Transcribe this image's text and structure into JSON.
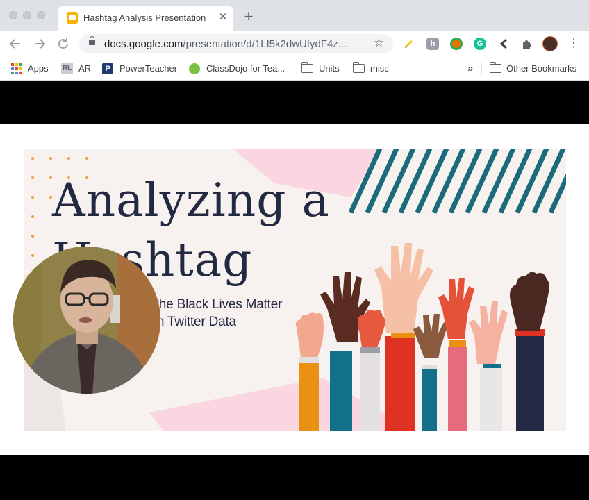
{
  "browser": {
    "tab": {
      "title": "Hashtag Analysis Presentation",
      "close_glyph": "✕"
    },
    "new_tab_glyph": "+",
    "omnibox": {
      "host": "docs.google.com",
      "path": "/presentation/d/1LI5k2dwUfydF4z..."
    },
    "bookmarks": [
      {
        "label": "Apps"
      },
      {
        "label": "AR"
      },
      {
        "label": "PowerTeacher"
      },
      {
        "label": "ClassDojo for Tea..."
      },
      {
        "label": "Units"
      },
      {
        "label": "misc"
      }
    ],
    "overflow_glyph": "»",
    "other_bookmarks": "Other Bookmarks",
    "ext_badges": {
      "honey": "h",
      "grammarly": "G"
    }
  },
  "slide": {
    "title_line1": "Analyzing a",
    "title_line2": "Hashtag",
    "subtitle_line1": "A Deeper Look at the Black Lives Matter",
    "subtitle_line2": "Movement Through Twitter Data"
  },
  "colors": {
    "title_text": "#232942",
    "stripe_teal": "#1b6b7d",
    "pink_blob": "#f9d6e0",
    "dot_orange": "#e8a13a",
    "slide_bg": "#f7f2ef",
    "tab_strip": "#dee1e6"
  },
  "icons": {
    "back": "arrow-left-icon",
    "forward": "arrow-right-icon",
    "reload": "reload-icon",
    "lock": "lock-icon",
    "bookmark_star": "star-icon",
    "extensions": "puzzle-icon",
    "menu": "kebab-menu-icon"
  }
}
